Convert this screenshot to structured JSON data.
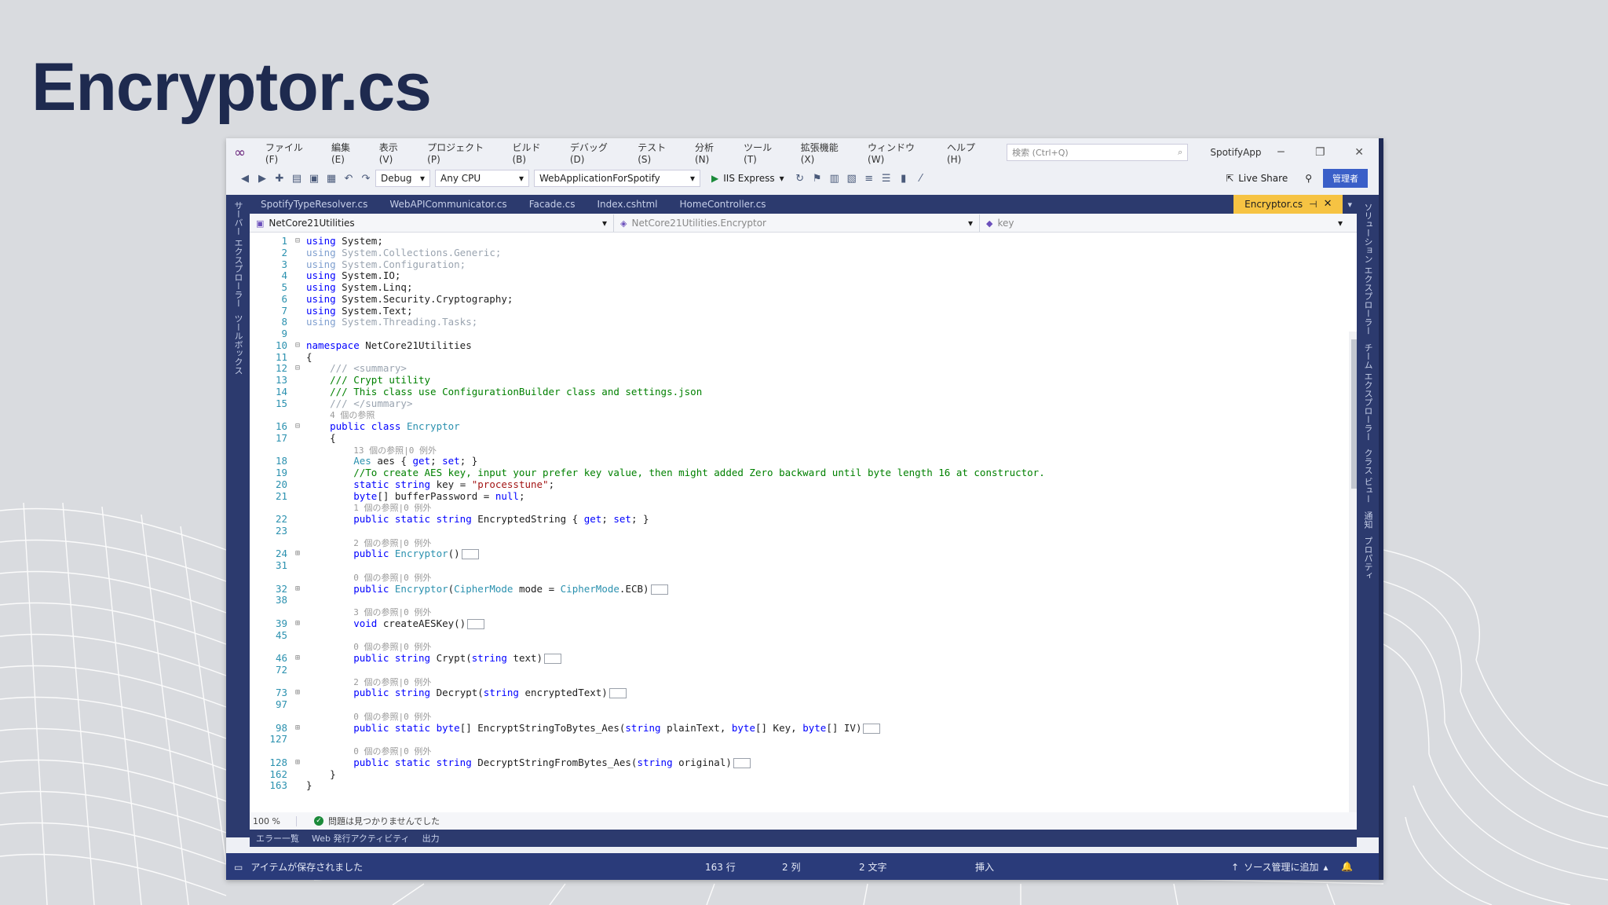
{
  "slide_title": "Encryptor.cs",
  "titlebar": {
    "menus": [
      "ファイル(F)",
      "編集(E)",
      "表示(V)",
      "プロジェクト(P)",
      "ビルド(B)",
      "デバッグ(D)",
      "テスト(S)",
      "分析(N)",
      "ツール(T)",
      "拡張機能(X)",
      "ウィンドウ(W)",
      "ヘルプ(H)"
    ],
    "search_placeholder": "検索 (Ctrl+Q)",
    "solution": "SpotifyApp"
  },
  "toolbar": {
    "config": "Debug",
    "platform": "Any CPU",
    "project": "WebApplicationForSpotify",
    "run_label": "IIS Express",
    "live_share": "Live Share",
    "admin": "管理者"
  },
  "left_strip": [
    "サーバー エクスプローラー",
    "ツールボックス"
  ],
  "right_strip": [
    "ソリューション エクスプローラー",
    "チーム エクスプローラー",
    "クラス ビュー",
    "通知",
    "プロパティ"
  ],
  "tabs": [
    "SpotifyTypeResolver.cs",
    "WebAPICommunicator.cs",
    "Facade.cs",
    "Index.cshtml",
    "HomeController.cs"
  ],
  "active_tab": "Encryptor.cs",
  "nav": {
    "project": "NetCore21Utilities",
    "class": "NetCore21Utilities.Encryptor",
    "member": "key"
  },
  "code_lines": [
    {
      "n": "1",
      "fold": "⊟",
      "html": "<span class='k'>using</span> System;"
    },
    {
      "n": "2",
      "fold": "",
      "html": "<span class='kf'>using</span> <span class='pf'>System.Collections.Generic;</span>"
    },
    {
      "n": "3",
      "fold": "",
      "html": "<span class='kf'>using</span> <span class='pf'>System.Configuration;</span>"
    },
    {
      "n": "4",
      "fold": "",
      "html": "<span class='k'>using</span> System.IO;"
    },
    {
      "n": "5",
      "fold": "",
      "html": "<span class='k'>using</span> System.Linq;"
    },
    {
      "n": "6",
      "fold": "",
      "html": "<span class='k'>using</span> System.Security.Cryptography;"
    },
    {
      "n": "7",
      "fold": "",
      "html": "<span class='k'>using</span> System.Text;"
    },
    {
      "n": "8",
      "fold": "",
      "html": "<span class='kf'>using</span> <span class='pf'>System.Threading.Tasks;</span>"
    },
    {
      "n": "9",
      "fold": "",
      "html": ""
    },
    {
      "n": "10",
      "fold": "⊟",
      "html": "<span class='k'>namespace</span> NetCore21Utilities"
    },
    {
      "n": "11",
      "fold": "",
      "html": "{"
    },
    {
      "n": "12",
      "fold": "⊟",
      "html": "    <span class='cf'>/// &lt;summary&gt;</span>"
    },
    {
      "n": "13",
      "fold": "",
      "html": "    <span class='c'>/// Crypt utility</span>"
    },
    {
      "n": "14",
      "fold": "",
      "html": "    <span class='c'>/// This class use ConfigurationBuilder class and settings.json</span>"
    },
    {
      "n": "15",
      "fold": "",
      "html": "    <span class='cf'>/// &lt;/summary&gt;</span>"
    },
    {
      "n": "",
      "fold": "",
      "html": "    <span class='ref'>4 個の参照</span>"
    },
    {
      "n": "16",
      "fold": "⊟",
      "html": "    <span class='k'>public class</span> <span class='t'>Encryptor</span>"
    },
    {
      "n": "17",
      "fold": "",
      "html": "    {"
    },
    {
      "n": "",
      "fold": "",
      "html": "        <span class='ref'>13 個の参照|0 例外</span>"
    },
    {
      "n": "18",
      "fold": "",
      "html": "        <span class='t'>Aes</span> aes { <span class='k'>get</span>; <span class='k'>set</span>; }"
    },
    {
      "n": "19",
      "fold": "",
      "html": "        <span class='c'>//To create AES key, input your prefer key value, then might added Zero backward until byte length 16 at constructor.</span>"
    },
    {
      "n": "20",
      "fold": "",
      "html": "        <span class='k'>static string</span> key = <span class='s'>\"processtune\"</span>;"
    },
    {
      "n": "21",
      "fold": "",
      "html": "        <span class='k'>byte</span>[] bufferPassword = <span class='k'>null</span>;"
    },
    {
      "n": "",
      "fold": "",
      "html": "        <span class='ref'>1 個の参照|0 例外</span>"
    },
    {
      "n": "22",
      "fold": "",
      "html": "        <span class='k'>public static string</span> EncryptedString { <span class='k'>get</span>; <span class='k'>set</span>; }"
    },
    {
      "n": "23",
      "fold": "",
      "html": ""
    },
    {
      "n": "",
      "fold": "",
      "html": "        <span class='ref'>2 個の参照|0 例外</span>"
    },
    {
      "n": "24",
      "fold": "⊞",
      "html": "        <span class='k'>public</span> <span class='t'>Encryptor</span>()<span class='collapsed'></span>"
    },
    {
      "n": "31",
      "fold": "",
      "html": ""
    },
    {
      "n": "",
      "fold": "",
      "html": "        <span class='ref'>0 個の参照|0 例外</span>"
    },
    {
      "n": "32",
      "fold": "⊞",
      "html": "        <span class='k'>public</span> <span class='t'>Encryptor</span>(<span class='t'>CipherMode</span> mode = <span class='t'>CipherMode</span>.ECB)<span class='collapsed'></span>"
    },
    {
      "n": "38",
      "fold": "",
      "html": ""
    },
    {
      "n": "",
      "fold": "",
      "html": "        <span class='ref'>3 個の参照|0 例外</span>"
    },
    {
      "n": "39",
      "fold": "⊞",
      "html": "        <span class='k'>void</span> createAESKey()<span class='collapsed'></span>"
    },
    {
      "n": "45",
      "fold": "",
      "html": ""
    },
    {
      "n": "",
      "fold": "",
      "html": "        <span class='ref'>0 個の参照|0 例外</span>"
    },
    {
      "n": "46",
      "fold": "⊞",
      "html": "        <span class='k'>public string</span> Crypt(<span class='k'>string</span> text)<span class='collapsed'></span>"
    },
    {
      "n": "72",
      "fold": "",
      "html": ""
    },
    {
      "n": "",
      "fold": "",
      "html": "        <span class='ref'>2 個の参照|0 例外</span>"
    },
    {
      "n": "73",
      "fold": "⊞",
      "html": "        <span class='k'>public string</span> Decrypt(<span class='k'>string</span> encryptedText)<span class='collapsed'></span>"
    },
    {
      "n": "97",
      "fold": "",
      "html": ""
    },
    {
      "n": "",
      "fold": "",
      "html": "        <span class='ref'>0 個の参照|0 例外</span>"
    },
    {
      "n": "98",
      "fold": "⊞",
      "html": "        <span class='k'>public static byte</span>[] EncryptStringToBytes_Aes(<span class='k'>string</span> plainText, <span class='k'>byte</span>[] Key, <span class='k'>byte</span>[] IV)<span class='collapsed'></span>"
    },
    {
      "n": "127",
      "fold": "",
      "html": ""
    },
    {
      "n": "",
      "fold": "",
      "html": "        <span class='ref'>0 個の参照|0 例外</span>"
    },
    {
      "n": "128",
      "fold": "⊞",
      "html": "        <span class='k'>public static string</span> DecryptStringFromBytes_Aes(<span class='k'>string</span> original)<span class='collapsed'></span>"
    },
    {
      "n": "162",
      "fold": "",
      "html": "    }"
    },
    {
      "n": "163",
      "fold": "",
      "html": "}"
    }
  ],
  "editor_status": {
    "zoom": "100 %",
    "issues": "問題は見つかりませんでした"
  },
  "tool_tabs": [
    "エラー一覧",
    "Web 発行アクティビティ",
    "出力"
  ],
  "statusbar": {
    "message": "アイテムが保存されました",
    "line": "163 行",
    "col": "2 列",
    "ch": "2 文字",
    "mode": "挿入",
    "source_control": "ソース管理に追加"
  },
  "colors": {
    "title": "#1e2a4f",
    "vs_frame": "#2c3a6e",
    "active_tab": "#f6c343",
    "statusbar": "#2a3b7a"
  }
}
